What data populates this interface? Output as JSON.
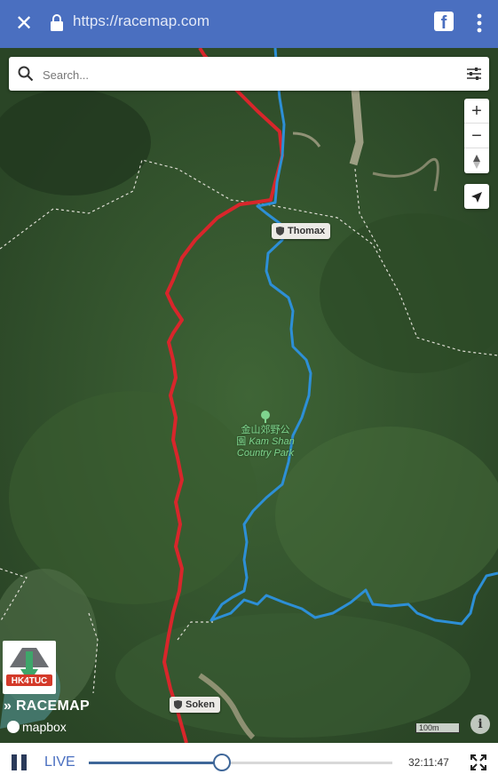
{
  "browser": {
    "url": "https://racemap.com",
    "close_icon": "close-icon",
    "lock_icon": "lock-icon",
    "share_icon": "facebook-icon",
    "menu_icon": "more-vertical-icon"
  },
  "search": {
    "placeholder": "Search...",
    "value": ""
  },
  "map_controls": {
    "zoom_in": "+",
    "zoom_out": "−",
    "compass_icon": "compass-icon",
    "locate_icon": "locate-arrow-icon"
  },
  "runners": [
    {
      "name": "Thomax"
    },
    {
      "name": "Soken"
    }
  ],
  "park_label": {
    "name_zh_line1": "金山郊野公",
    "name_zh_line2": "園",
    "name_en_line1": "Kam Shan",
    "name_en_line2": "Country Park"
  },
  "branding": {
    "event_logo_text": "HK4TUC",
    "racemap_label": "RACEMAP",
    "mapbox_label": "mapbox"
  },
  "scale_label": "100m",
  "playback": {
    "status": "LIVE",
    "progress_fraction": 0.44,
    "time": "32:11:47"
  },
  "colors": {
    "browser_bar": "#4a6fc0",
    "route_red": "#d8262b",
    "route_blue": "#2d8fd6",
    "progress_fill": "#3f6799"
  }
}
